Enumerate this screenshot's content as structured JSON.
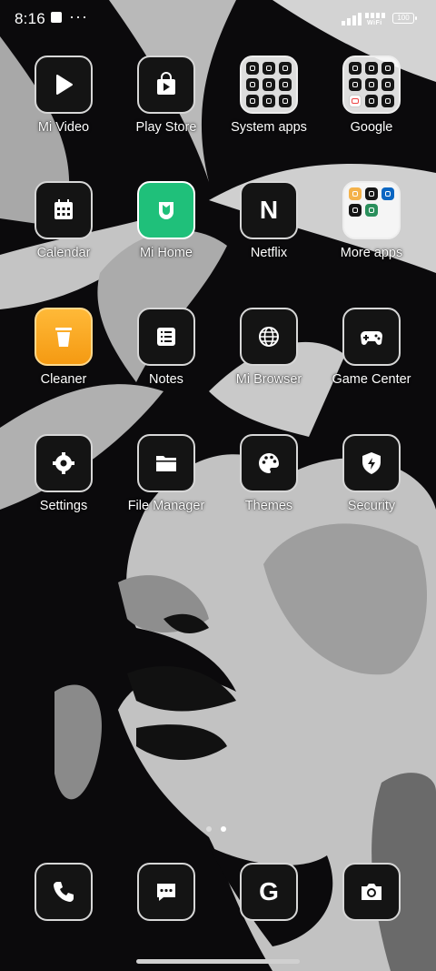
{
  "status_bar": {
    "time": "8:16",
    "wifi_label": "WiFi",
    "battery": "100"
  },
  "apps": [
    {
      "label": "Mi Video",
      "icon": "play-icon"
    },
    {
      "label": "Play Store",
      "icon": "play-store-icon"
    },
    {
      "label": "System apps",
      "icon": "folder-system-apps-icon"
    },
    {
      "label": "Google",
      "icon": "folder-google-icon"
    },
    {
      "label": "Calendar",
      "icon": "calendar-icon"
    },
    {
      "label": "Mi Home",
      "icon": "mi-home-icon"
    },
    {
      "label": "Netflix",
      "icon": "netflix-icon",
      "glyph": "N"
    },
    {
      "label": "More apps",
      "icon": "folder-more-apps-icon"
    },
    {
      "label": "Cleaner",
      "icon": "trash-icon"
    },
    {
      "label": "Notes",
      "icon": "notes-icon"
    },
    {
      "label": "Mi Browser",
      "icon": "globe-icon"
    },
    {
      "label": "Game Center",
      "icon": "gamepad-icon"
    },
    {
      "label": "Settings",
      "icon": "gear-icon"
    },
    {
      "label": "File Manager",
      "icon": "folder-icon"
    },
    {
      "label": "Themes",
      "icon": "palette-icon"
    },
    {
      "label": "Security",
      "icon": "shield-icon"
    }
  ],
  "dock": [
    {
      "name": "phone",
      "icon": "phone-icon"
    },
    {
      "name": "messages",
      "icon": "message-icon"
    },
    {
      "name": "google",
      "icon": "google-g-icon",
      "glyph": "G"
    },
    {
      "name": "camera",
      "icon": "camera-icon"
    }
  ],
  "colors": {
    "mi_home": "#1fc07a",
    "cleaner": "#f7a11a",
    "icon_bg": "#141414",
    "icon_border": "#d7d7d7"
  },
  "page_indicator": {
    "pages": 2,
    "current": 2
  }
}
